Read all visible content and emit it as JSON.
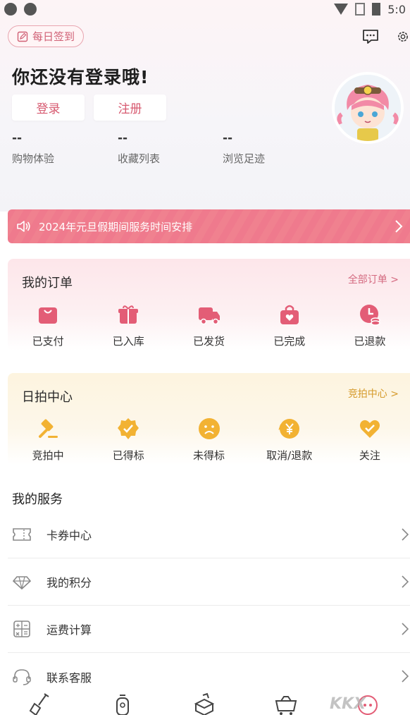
{
  "status_bar": {
    "time": "5:0"
  },
  "header": {
    "checkin_label": "每日签到",
    "title": "你还没有登录哦!",
    "login_label": "登录",
    "register_label": "注册"
  },
  "stats": [
    {
      "value": "--",
      "label": "购物体验"
    },
    {
      "value": "--",
      "label": "收藏列表"
    },
    {
      "value": "--",
      "label": "浏览足迹"
    }
  ],
  "notice": {
    "text": "2024年元旦假期间服务时间安排"
  },
  "orders": {
    "title": "我的订单",
    "link": "全部订单 >",
    "accent": "#e35d76",
    "items": [
      {
        "label": "已支付",
        "icon": "bag-icon"
      },
      {
        "label": "已入库",
        "icon": "gift-icon"
      },
      {
        "label": "已发货",
        "icon": "truck-icon"
      },
      {
        "label": "已完成",
        "icon": "heart-bag-icon"
      },
      {
        "label": "已退款",
        "icon": "refund-icon"
      }
    ]
  },
  "auction": {
    "title": "日拍中心",
    "link": "竞拍中心 >",
    "accent": "#f2b233",
    "items": [
      {
        "label": "竞拍中",
        "icon": "gavel-icon"
      },
      {
        "label": "已得标",
        "icon": "badge-check-icon"
      },
      {
        "label": "未得标",
        "icon": "sad-face-icon"
      },
      {
        "label": "取消/退款",
        "icon": "yen-refund-icon"
      },
      {
        "label": "关注",
        "icon": "heart-check-icon"
      }
    ]
  },
  "services": {
    "title": "我的服务",
    "items": [
      {
        "label": "卡券中心",
        "icon": "ticket-icon"
      },
      {
        "label": "我的积分",
        "icon": "diamond-icon"
      },
      {
        "label": "运费计算",
        "icon": "calculator-icon"
      },
      {
        "label": "联系客服",
        "icon": "headset-icon"
      }
    ]
  },
  "tabbar": {
    "items": [
      {
        "icon": "shovel-icon"
      },
      {
        "icon": "lantern-icon"
      },
      {
        "icon": "box-icon"
      },
      {
        "icon": "cart-icon"
      },
      {
        "icon": "profile-icon"
      }
    ]
  },
  "watermark": "KKX"
}
